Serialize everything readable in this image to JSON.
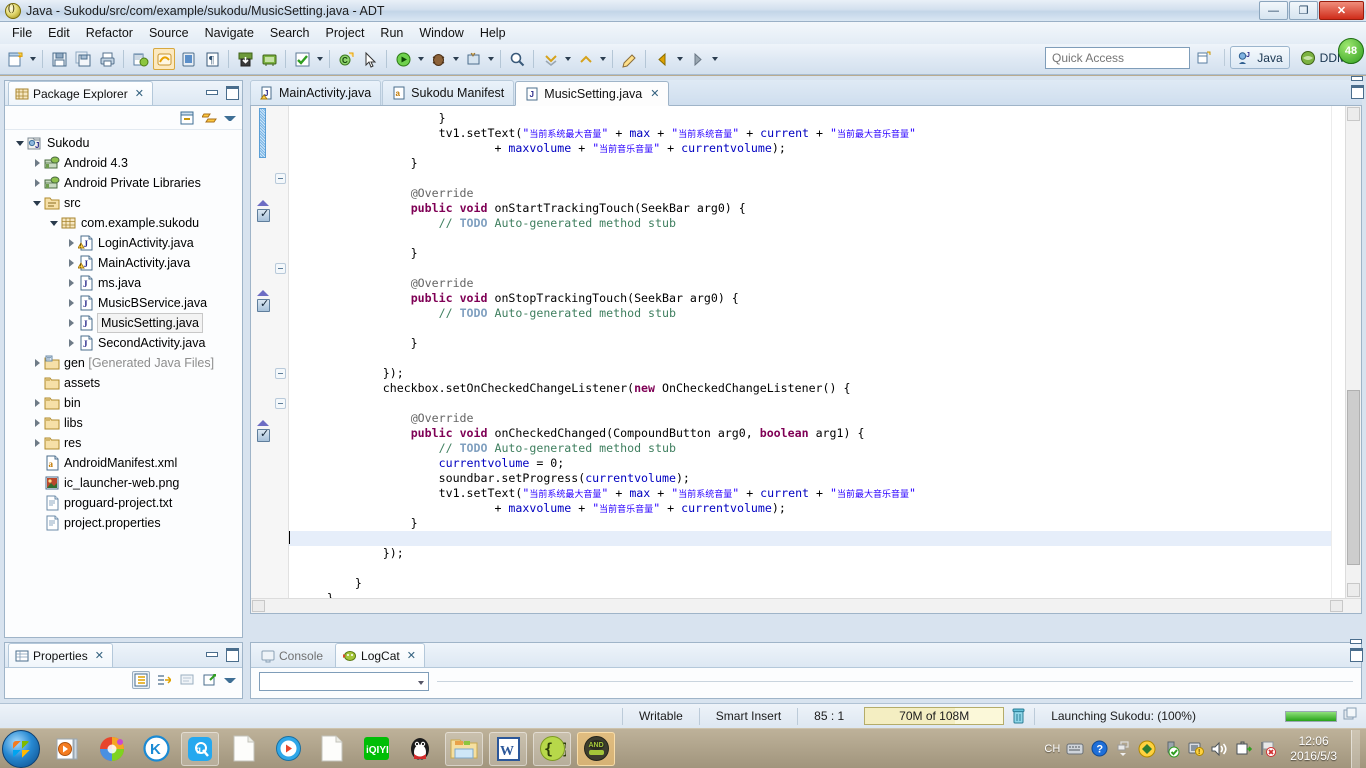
{
  "window": {
    "title": "Java - Sukodu/src/com/example/sukodu/MusicSetting.java - ADT",
    "icon": "eclipse-adt-icon",
    "minimize": "—",
    "maximize": "❐",
    "close": "✕"
  },
  "menubar": {
    "items": [
      {
        "label": "File"
      },
      {
        "label": "Edit"
      },
      {
        "label": "Refactor"
      },
      {
        "label": "Source"
      },
      {
        "label": "Navigate"
      },
      {
        "label": "Search"
      },
      {
        "label": "Project"
      },
      {
        "label": "Run"
      },
      {
        "label": "Window"
      },
      {
        "label": "Help"
      }
    ]
  },
  "toolbar": {
    "buttons": [
      {
        "name": "new-wizard-icon"
      },
      {
        "name": "save-icon"
      },
      {
        "name": "save-all-icon"
      },
      {
        "name": "print-icon"
      },
      {
        "name": "new-android-project-icon"
      },
      {
        "name": "android-sdk-manager-icon"
      },
      {
        "name": "android-virtual-device-manager-icon"
      },
      {
        "name": "lint-warnings-icon"
      },
      {
        "name": "open-perspective-icon"
      },
      {
        "name": "ddms-icon"
      },
      {
        "name": "run-icon"
      },
      {
        "name": "debug-icon"
      },
      {
        "name": "external-tools-icon"
      },
      {
        "name": "new-java-class-icon"
      },
      {
        "name": "search-icon"
      },
      {
        "name": "next-annotation-icon"
      },
      {
        "name": "previous-annotation-icon"
      },
      {
        "name": "last-edit-location-icon"
      },
      {
        "name": "back-icon"
      },
      {
        "name": "forward-icon"
      }
    ]
  },
  "quick_access": {
    "placeholder": "Quick Access",
    "value": ""
  },
  "perspectives": {
    "open_perspective_label": "",
    "items": [
      {
        "label": "Java",
        "icon": "java-perspective-icon"
      },
      {
        "label": "DDMS",
        "icon": "ddms-perspective-icon"
      }
    ],
    "notification_badge": "48"
  },
  "package_explorer": {
    "tab_label": "Package Explorer",
    "close_glyph": "✕",
    "toolbar": [
      {
        "name": "collapse-all-icon"
      },
      {
        "name": "link-with-editor-icon"
      },
      {
        "name": "view-menu-icon"
      }
    ],
    "tree": [
      {
        "label": "Sukodu",
        "indent": 0,
        "twist": "open",
        "icon": "java-project-icon",
        "selected": false
      },
      {
        "label": "Android 4.3",
        "indent": 1,
        "twist": "closed",
        "icon": "android-library-icon",
        "selected": false
      },
      {
        "label": "Android Private Libraries",
        "indent": 1,
        "twist": "closed",
        "icon": "android-library-icon",
        "selected": false
      },
      {
        "label": "src",
        "indent": 1,
        "twist": "open",
        "icon": "source-folder-icon",
        "selected": false
      },
      {
        "label": "com.example.sukodu",
        "indent": 2,
        "twist": "open",
        "icon": "package-icon",
        "selected": false
      },
      {
        "label": "LoginActivity.java",
        "indent": 3,
        "twist": "closed",
        "icon": "java-file-warning-icon",
        "selected": false
      },
      {
        "label": "MainActivity.java",
        "indent": 3,
        "twist": "closed",
        "icon": "java-file-warning-icon",
        "selected": false
      },
      {
        "label": "ms.java",
        "indent": 3,
        "twist": "closed",
        "icon": "java-file-icon",
        "selected": false
      },
      {
        "label": "MusicBService.java",
        "indent": 3,
        "twist": "closed",
        "icon": "java-file-icon",
        "selected": false
      },
      {
        "label": "MusicSetting.java",
        "indent": 3,
        "twist": "closed",
        "icon": "java-file-icon",
        "selected": true
      },
      {
        "label": "SecondActivity.java",
        "indent": 3,
        "twist": "closed",
        "icon": "java-file-icon",
        "selected": false
      },
      {
        "label": "gen ",
        "suffix": "[Generated Java Files]",
        "indent": 1,
        "twist": "closed",
        "icon": "gen-folder-icon",
        "selected": false
      },
      {
        "label": "assets",
        "indent": 1,
        "twist": "none",
        "icon": "folder-icon",
        "selected": false
      },
      {
        "label": "bin",
        "indent": 1,
        "twist": "closed",
        "icon": "folder-icon",
        "selected": false
      },
      {
        "label": "libs",
        "indent": 1,
        "twist": "closed",
        "icon": "folder-icon",
        "selected": false
      },
      {
        "label": "res",
        "indent": 1,
        "twist": "closed",
        "icon": "folder-icon",
        "selected": false
      },
      {
        "label": "AndroidManifest.xml",
        "indent": 1,
        "twist": "none",
        "icon": "xml-file-icon",
        "selected": false
      },
      {
        "label": "ic_launcher-web.png",
        "indent": 1,
        "twist": "none",
        "icon": "image-file-icon",
        "selected": false
      },
      {
        "label": "proguard-project.txt",
        "indent": 1,
        "twist": "none",
        "icon": "text-file-icon",
        "selected": false
      },
      {
        "label": "project.properties",
        "indent": 1,
        "twist": "none",
        "icon": "text-file-icon",
        "selected": false
      }
    ]
  },
  "properties_view": {
    "tab_label": "Properties",
    "close_glyph": "✕",
    "toolbar": [
      {
        "name": "show-categories-icon"
      },
      {
        "name": "show-advanced-properties-icon"
      },
      {
        "name": "restore-default-value-icon"
      },
      {
        "name": "pin-to-selection-icon"
      },
      {
        "name": "view-menu-icon"
      }
    ]
  },
  "editor": {
    "tabs": [
      {
        "label": "MainActivity.java",
        "icon": "java-file-warning-icon",
        "active": false,
        "closable": false
      },
      {
        "label": "Sukodu Manifest",
        "icon": "android-manifest-icon",
        "active": false,
        "closable": false
      },
      {
        "label": "MusicSetting.java",
        "icon": "java-file-icon",
        "active": true,
        "closable": true
      }
    ],
    "close_glyph": "✕",
    "lines": [
      {
        "indent": 0,
        "html": "                    }"
      },
      {
        "indent": 0,
        "html": "                    <c>tv1</c>.setText(<s>\"当前系统最大音量\"</s> + <f>max</f> + <s>\"当前系统音量\"</s> + <f>current</f> + <s>\"当前最大音乐音量\"</s>"
      },
      {
        "indent": 0,
        "html": "                            + <f>maxvolume</f> + <s>\"当前音乐音量\"</s> + <f>currentvolume</f>);"
      },
      {
        "indent": 0,
        "html": "                }"
      },
      {
        "indent": 0,
        "html": ""
      },
      {
        "indent": 0,
        "html": "                <a>@Override</a>"
      },
      {
        "indent": 0,
        "html": "                <k>public</k> <k>void</k> onStartTrackingTouch(SeekBar arg0) {"
      },
      {
        "indent": 0,
        "html": "                    <m>// </m><t>TODO</t><m> Auto-generated method stub</m>"
      },
      {
        "indent": 0,
        "html": ""
      },
      {
        "indent": 0,
        "html": "                }"
      },
      {
        "indent": 0,
        "html": ""
      },
      {
        "indent": 0,
        "html": "                <a>@Override</a>"
      },
      {
        "indent": 0,
        "html": "                <k>public</k> <k>void</k> onStopTrackingTouch(SeekBar arg0) {"
      },
      {
        "indent": 0,
        "html": "                    <m>// </m><t>TODO</t><m> Auto-generated method stub</m>"
      },
      {
        "indent": 0,
        "html": ""
      },
      {
        "indent": 0,
        "html": "                }"
      },
      {
        "indent": 0,
        "html": ""
      },
      {
        "indent": 0,
        "html": "            });"
      },
      {
        "indent": 0,
        "html": "            <c>checkbox</c>.setOnCheckedChangeListener(<k>new</k> OnCheckedChangeListener() {"
      },
      {
        "indent": 0,
        "html": ""
      },
      {
        "indent": 0,
        "html": "                <a>@Override</a>"
      },
      {
        "indent": 0,
        "html": "                <k>public</k> <k>void</k> onCheckedChanged(CompoundButton arg0, <k>boolean</k> arg1) {"
      },
      {
        "indent": 0,
        "html": "                    <m>// </m><t>TODO</t><m> Auto-generated method stub</m>"
      },
      {
        "indent": 0,
        "html": "                    <f>currentvolume</f> = 0;"
      },
      {
        "indent": 0,
        "html": "                    <c>soundbar</c>.setProgress(<f>currentvolume</f>);"
      },
      {
        "indent": 0,
        "html": "                    <c>tv1</c>.setText(<s>\"当前系统最大音量\"</s> + <f>max</f> + <s>\"当前系统音量\"</s> + <f>current</f> + <s>\"当前最大音乐音量\"</s>"
      },
      {
        "indent": 0,
        "html": "                            + <f>maxvolume</f> + <s>\"当前音乐音量\"</s> + <f>currentvolume</f>);"
      },
      {
        "indent": 0,
        "html": "                }"
      },
      {
        "indent": 0,
        "html": "",
        "current": true,
        "caret": true
      },
      {
        "indent": 0,
        "html": "            });"
      },
      {
        "indent": 0,
        "html": ""
      },
      {
        "indent": 0,
        "html": "        }"
      },
      {
        "indent": 0,
        "html": "    }"
      }
    ]
  },
  "console_view": {
    "tabs": [
      {
        "label": "Console",
        "icon": "console-icon",
        "active": false
      },
      {
        "label": "LogCat",
        "icon": "logcat-icon",
        "active": true
      }
    ],
    "close_glyph": "✕",
    "filter_placeholder": "",
    "filter_value": ""
  },
  "statusbar": {
    "writable": "Writable",
    "insert_mode": "Smart Insert",
    "position": "85 : 1",
    "heap": "70M of 108M",
    "heap_percent": 65,
    "trash_icon": "trash-icon",
    "task": "Launching Sukodu: (100%)",
    "progress_percent": 100
  },
  "taskbar": {
    "start_label": "start",
    "items": [
      {
        "name": "taskbar-media-player",
        "icon": "media-player-icon",
        "state": "pinned"
      },
      {
        "name": "taskbar-browser",
        "icon": "colorful-ball-icon",
        "state": "pinned"
      },
      {
        "name": "taskbar-kingsoft",
        "icon": "k-circle-icon",
        "state": "pinned"
      },
      {
        "name": "taskbar-sogou",
        "icon": "sogou-icon",
        "state": "open"
      },
      {
        "name": "taskbar-document-1",
        "icon": "document-icon",
        "state": "pinned"
      },
      {
        "name": "taskbar-player",
        "icon": "play-circle-icon",
        "state": "pinned"
      },
      {
        "name": "taskbar-document-2",
        "icon": "document-icon",
        "state": "pinned"
      },
      {
        "name": "taskbar-iqiyi",
        "icon": "iqiyi-icon",
        "state": "pinned"
      },
      {
        "name": "taskbar-qq",
        "icon": "qq-penguin-icon",
        "state": "pinned"
      },
      {
        "name": "taskbar-explorer",
        "icon": "folder-window-icon",
        "state": "open"
      },
      {
        "name": "taskbar-word",
        "icon": "word-icon",
        "state": "open"
      },
      {
        "name": "taskbar-json-tool",
        "icon": "braces-icon",
        "state": "open"
      },
      {
        "name": "taskbar-android-adt",
        "icon": "android-icon",
        "state": "active"
      }
    ],
    "tray": {
      "ime": "CH",
      "icons": [
        {
          "name": "keyboard-icon",
          "glyph": "⌨"
        },
        {
          "name": "help-icon",
          "glyph": "?"
        },
        {
          "name": "show-hidden-icons-icon",
          "glyph": "▴"
        },
        {
          "name": "antivirus-shield-icon",
          "glyph": "◆"
        },
        {
          "name": "security-guard-icon",
          "glyph": "✔"
        },
        {
          "name": "network-icon",
          "glyph": "▮"
        },
        {
          "name": "volume-icon",
          "glyph": "◀"
        },
        {
          "name": "safely-remove-hardware-icon",
          "glyph": "⎘"
        },
        {
          "name": "flag-action-center-icon",
          "glyph": "⚑"
        }
      ],
      "time": "12:06",
      "date": "2016/5/3"
    }
  }
}
